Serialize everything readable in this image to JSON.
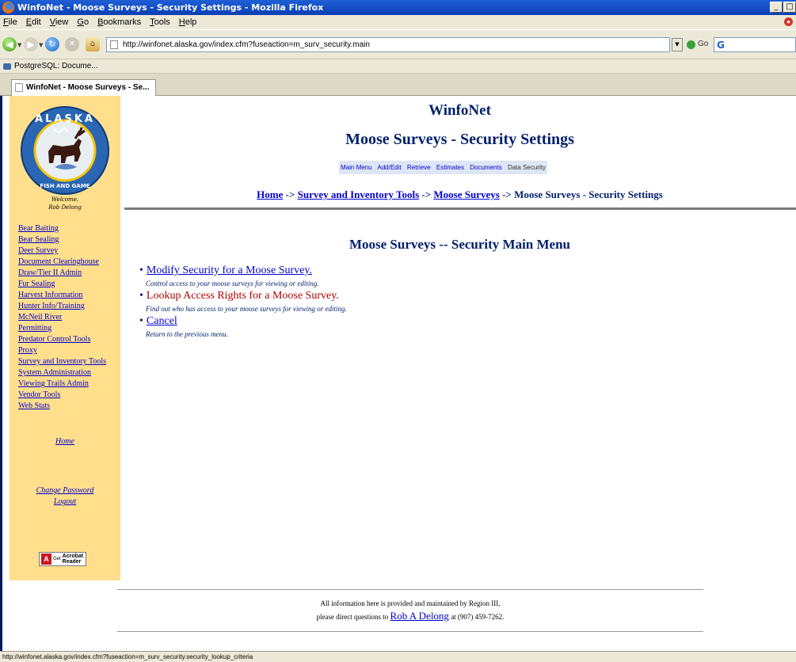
{
  "window": {
    "title": "WinfoNet - Moose Surveys - Security Settings - Mozilla Firefox",
    "minimize": "_",
    "maximize": "□"
  },
  "menubar": [
    "File",
    "Edit",
    "View",
    "Go",
    "Bookmarks",
    "Tools",
    "Help"
  ],
  "toolbar": {
    "url": "http://winfonet.alaska.gov/index.cfm?fuseaction=m_surv_security.main",
    "go_label": "Go",
    "search_icon": "G"
  },
  "bookmarks_bar": {
    "item": "PostgreSQL: Docume..."
  },
  "tab": {
    "label": "WinfoNet - Moose Surveys - Se..."
  },
  "sidebar": {
    "welcome_line1": "Welcome,",
    "welcome_line2": "Rob Delong",
    "links": [
      "Bear Baiting",
      "Bear Sealing",
      "Deer Survey",
      "Document Clearinghouse",
      "Draw/Tier II Admin",
      "Fur Sealing",
      "Harvest Information",
      "Hunter Info/Training",
      "McNeil River",
      "Permitting",
      "Predator Control Tools",
      "Proxy",
      "Survey and Inventory Tools",
      "System Administration",
      "Viewing Trails Admin",
      "Vendor Tools",
      "Web Stats"
    ],
    "home": "Home",
    "change_password": "Change Password",
    "logout": "Logout",
    "acrobat_get": "Get",
    "acrobat_line1": "Acrobat",
    "acrobat_line2": "Reader"
  },
  "header": {
    "app_title": "WinfoNet",
    "page_title": "Moose Surveys - Security Settings",
    "subnav": [
      "Main Menu",
      "Add/Edit",
      "Retrieve",
      "Estimates",
      "Documents"
    ],
    "subnav_current": "Data Security",
    "breadcrumb": {
      "home": "Home",
      "sep": " -> ",
      "survey_tools": "Survey and Inventory Tools",
      "moose": "Moose Surveys",
      "current": "Moose Surveys - Security Settings"
    }
  },
  "main": {
    "menu_title": "Moose Surveys -- Security Main Menu",
    "items": [
      {
        "label": "Modify Security for a Moose Survey.",
        "desc": "Control access to your moose surveys for viewing or editing."
      },
      {
        "label": "Lookup Access Rights for a Moose Survey.",
        "desc": "Find out who has access to your moose surveys for viewing or editing."
      },
      {
        "label": "Cancel",
        "desc": "Return to the previous menu."
      }
    ]
  },
  "footer": {
    "line1": "All information here is provided and maintained by Region III,",
    "line2_pre": "please direct questions to ",
    "contact": "Rob A Delong",
    "line2_post": " at (907) 459-7262."
  },
  "status": "http://winfonet.alaska.gov/index.cfm?fuseaction=m_surv_security.security_lookup_criteria",
  "colors": {
    "sidebar_bg": "#ffdf8c",
    "title_navy": "#001f6b",
    "link_blue": "#0000cc",
    "hover_red": "#b30000"
  }
}
